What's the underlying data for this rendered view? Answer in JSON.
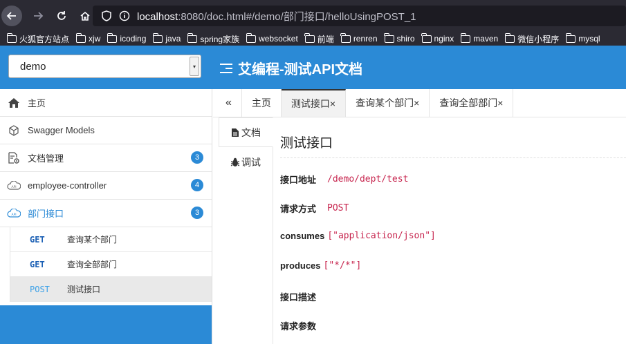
{
  "browser": {
    "url_host": "localhost",
    "url_rest": ":8080/doc.html#/demo/部门接口/helloUsingPOST_1",
    "bookmarks": [
      "火狐官方站点",
      "xjw",
      "icoding",
      "java",
      "spring家族",
      "websocket",
      "前端",
      "renren",
      "shiro",
      "nginx",
      "maven",
      "微信小程序",
      "mysql"
    ]
  },
  "header": {
    "group_value": "demo",
    "title": "艾编程-测试API文档"
  },
  "sidebar": {
    "items": [
      {
        "label": "主页",
        "icon": "home-icon"
      },
      {
        "label": "Swagger Models",
        "icon": "cube-icon"
      },
      {
        "label": "文档管理",
        "icon": "doc-gear-icon",
        "badge": "3"
      },
      {
        "label": "employee-controller",
        "icon": "api-cloud-icon",
        "badge": "4"
      },
      {
        "label": "部门接口",
        "icon": "api-cloud-icon",
        "badge": "3"
      }
    ],
    "sub_items": [
      {
        "method": "GET",
        "name": "查询某个部门"
      },
      {
        "method": "GET",
        "name": "查询全部部门"
      },
      {
        "method": "POST",
        "name": "测试接口"
      }
    ]
  },
  "tabs": {
    "collapse": "«",
    "items": [
      "主页",
      "测试接口×",
      "查询某个部门×",
      "查询全部部门×"
    ]
  },
  "vtabs": [
    "文档",
    "调试"
  ],
  "content": {
    "title": "测试接口",
    "fields": [
      {
        "key": "接口地址",
        "value": "/demo/dept/test"
      },
      {
        "key": "请求方式",
        "value": "POST"
      },
      {
        "key": "consumes",
        "value": "[\"application/json\"]"
      },
      {
        "key": "produces",
        "value": "[\"*/*\"]"
      },
      {
        "key": "接口描述",
        "value": ""
      },
      {
        "key": "请求参数",
        "value": ""
      }
    ]
  },
  "colors": {
    "brand": "#2b8ad6",
    "code": "#c7254e",
    "browser_chrome": "#2b2a33"
  }
}
